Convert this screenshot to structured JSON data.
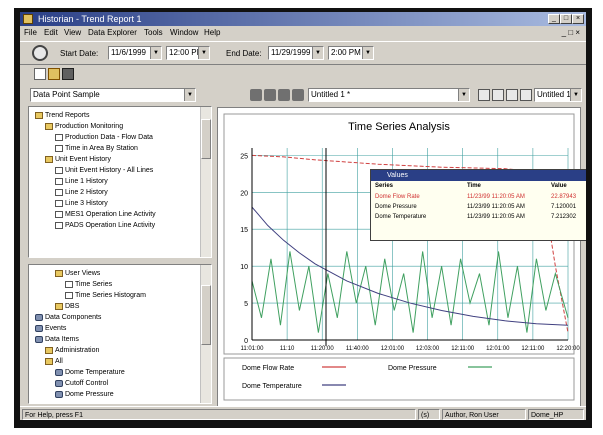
{
  "window": {
    "title": "Historian - Trend Report 1"
  },
  "menu": [
    "File",
    "Edit",
    "View",
    "Data Explorer",
    "Tools",
    "Window",
    "Help"
  ],
  "toolbar": {
    "start_label": "Start Date:",
    "start_date": "11/6/1999",
    "start_time": "12:00 PM",
    "end_label": "End Date:",
    "end_date": "11/29/1999",
    "end_time": "2:00 PM"
  },
  "left_combo": "Data Point Sample",
  "chart_combo_1": "Untitled 1 *",
  "chart_combo_2": "Untitled 1 *",
  "tree_top": [
    {
      "label": "Trend Reports",
      "indent": 0,
      "icon": "folder"
    },
    {
      "label": "Production Monitoring",
      "indent": 1,
      "icon": "folder"
    },
    {
      "label": "Production Data - Flow Data",
      "indent": 2,
      "icon": "doc"
    },
    {
      "label": "Time in Area By Station",
      "indent": 2,
      "icon": "doc"
    },
    {
      "label": "Unit Event History",
      "indent": 1,
      "icon": "folder"
    },
    {
      "label": "Unit Event History - All Lines",
      "indent": 2,
      "icon": "doc"
    },
    {
      "label": "Line 1 History",
      "indent": 2,
      "icon": "doc"
    },
    {
      "label": "Line 2 History",
      "indent": 2,
      "icon": "doc"
    },
    {
      "label": "Line 3 History",
      "indent": 2,
      "icon": "doc"
    },
    {
      "label": "MES1 Operation Line Activity",
      "indent": 2,
      "icon": "doc"
    },
    {
      "label": "PADS Operation Line Activity",
      "indent": 2,
      "icon": "doc"
    }
  ],
  "tree_bottom": [
    {
      "label": "User Views",
      "indent": 2,
      "icon": "folder"
    },
    {
      "label": "Time Series",
      "indent": 3,
      "icon": "doc"
    },
    {
      "label": "Time Series Histogram",
      "indent": 3,
      "icon": "doc"
    },
    {
      "label": "DBS",
      "indent": 2,
      "icon": "folder"
    },
    {
      "label": "Data Components",
      "indent": 0,
      "icon": "gear"
    },
    {
      "label": "Events",
      "indent": 0,
      "icon": "gear"
    },
    {
      "label": "Data Items",
      "indent": 0,
      "icon": "gear"
    },
    {
      "label": "Administration",
      "indent": 1,
      "icon": "folder"
    },
    {
      "label": "All",
      "indent": 1,
      "icon": "folder"
    },
    {
      "label": "Dome Temperature",
      "indent": 2,
      "icon": "gear"
    },
    {
      "label": "Cutoff Control",
      "indent": 2,
      "icon": "gear"
    },
    {
      "label": "Dome Pressure",
      "indent": 2,
      "icon": "gear"
    }
  ],
  "values_popup": {
    "title": "Values",
    "headers": [
      "Series",
      "Time",
      "Value"
    ],
    "rows": [
      {
        "series": "Dome Flow Rate",
        "time": "11/23/99 11:20:05 AM",
        "value": "22.87943",
        "color": "#d03030"
      },
      {
        "series": "Dome Pressure",
        "time": "11/23/99 11:20:05 AM",
        "value": "7.120001",
        "color": "#000000"
      },
      {
        "series": "Dome Temperature",
        "time": "11/23/99 11:20:05 AM",
        "value": "7.212302",
        "color": "#000000"
      }
    ]
  },
  "status": {
    "left": "For Help, press F1",
    "mode": "(s)",
    "user": "Author, Ron User",
    "machine": "Dome_HP"
  },
  "chart_data": {
    "type": "line",
    "title": "Time Series Analysis",
    "y_ticks": [
      "0",
      "5",
      "10",
      "15",
      "20",
      "25"
    ],
    "x_ticks": [
      "11:01:00",
      "11:10",
      "11:20:00",
      "11:40:00",
      "12:01:00",
      "12:03:00",
      "12:11:00",
      "12:01:00",
      "12:11:00",
      "12:20:00"
    ],
    "ylim": [
      0,
      26
    ],
    "grid": true,
    "series": [
      {
        "name": "Dome Flow Rate",
        "color": "#d04040",
        "x": [
          0,
          0.1,
          0.2,
          0.3,
          0.4,
          0.5,
          0.6,
          0.7,
          0.8,
          0.85,
          0.9,
          0.93,
          0.96,
          1.0
        ],
        "values": [
          25,
          24.8,
          24.4,
          24.1,
          23.8,
          23.6,
          23.4,
          23.3,
          23.2,
          23.0,
          21.5,
          18,
          10,
          1
        ]
      },
      {
        "name": "Dome Pressure",
        "color": "#40a060",
        "x": [
          0,
          0.03,
          0.06,
          0.09,
          0.12,
          0.15,
          0.18,
          0.21,
          0.24,
          0.27,
          0.3,
          0.33,
          0.36,
          0.39,
          0.42,
          0.45,
          0.48,
          0.51,
          0.54,
          0.57,
          0.6,
          0.63,
          0.66,
          0.69,
          0.72,
          0.75,
          0.78,
          0.81,
          0.84,
          0.87,
          0.9,
          0.93,
          0.96,
          1.0
        ],
        "values": [
          8,
          3,
          11,
          2,
          12,
          4,
          10,
          1,
          9,
          3,
          12,
          5,
          10,
          2,
          11,
          4,
          9,
          1,
          12,
          3,
          10,
          2,
          11,
          5,
          9,
          2,
          12,
          3,
          10,
          1,
          11,
          4,
          9,
          3
        ]
      },
      {
        "name": "Dome Temperature",
        "color": "#404080",
        "x": [
          0,
          0.05,
          0.1,
          0.15,
          0.2,
          0.3,
          0.4,
          0.5,
          0.6,
          0.7,
          0.8,
          0.9,
          1.0
        ],
        "values": [
          18,
          15.5,
          13.5,
          11.8,
          10.3,
          8,
          6.3,
          5,
          4,
          3.2,
          2.6,
          2.2,
          2.0
        ]
      }
    ]
  }
}
